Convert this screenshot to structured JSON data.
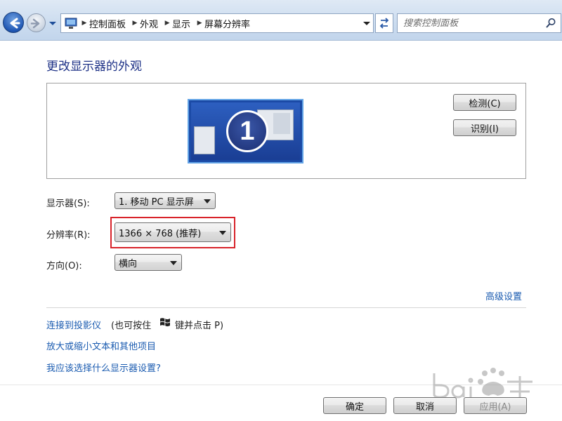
{
  "breadcrumb": {
    "items": [
      "控制面板",
      "外观",
      "显示",
      "屏幕分辨率"
    ]
  },
  "search": {
    "placeholder": "搜索控制面板"
  },
  "page": {
    "title": "更改显示器的外观"
  },
  "preview": {
    "monitor_number": "1",
    "detect_label": "检测(C)",
    "identify_label": "识别(I)"
  },
  "settings": {
    "display_label": "显示器(S):",
    "display_value": "1. 移动 PC 显示屏",
    "resolution_label": "分辨率(R):",
    "resolution_value": "1366 × 768 (推荐)",
    "orientation_label": "方向(O):",
    "orientation_value": "横向"
  },
  "links": {
    "advanced": "高级设置",
    "projector": "连接到投影仪",
    "projector_hint_pre": "(也可按住",
    "projector_hint_post": "键并点击 P)",
    "text_size": "放大或缩小文本和其他项目",
    "which_settings": "我应该选择什么显示器设置?"
  },
  "footer": {
    "ok_label": "确定",
    "cancel_label": "取消",
    "apply_label": "应用(A)"
  },
  "colors": {
    "link": "#1a5bb0",
    "title": "#1e3287",
    "highlight": "#d8232a"
  }
}
